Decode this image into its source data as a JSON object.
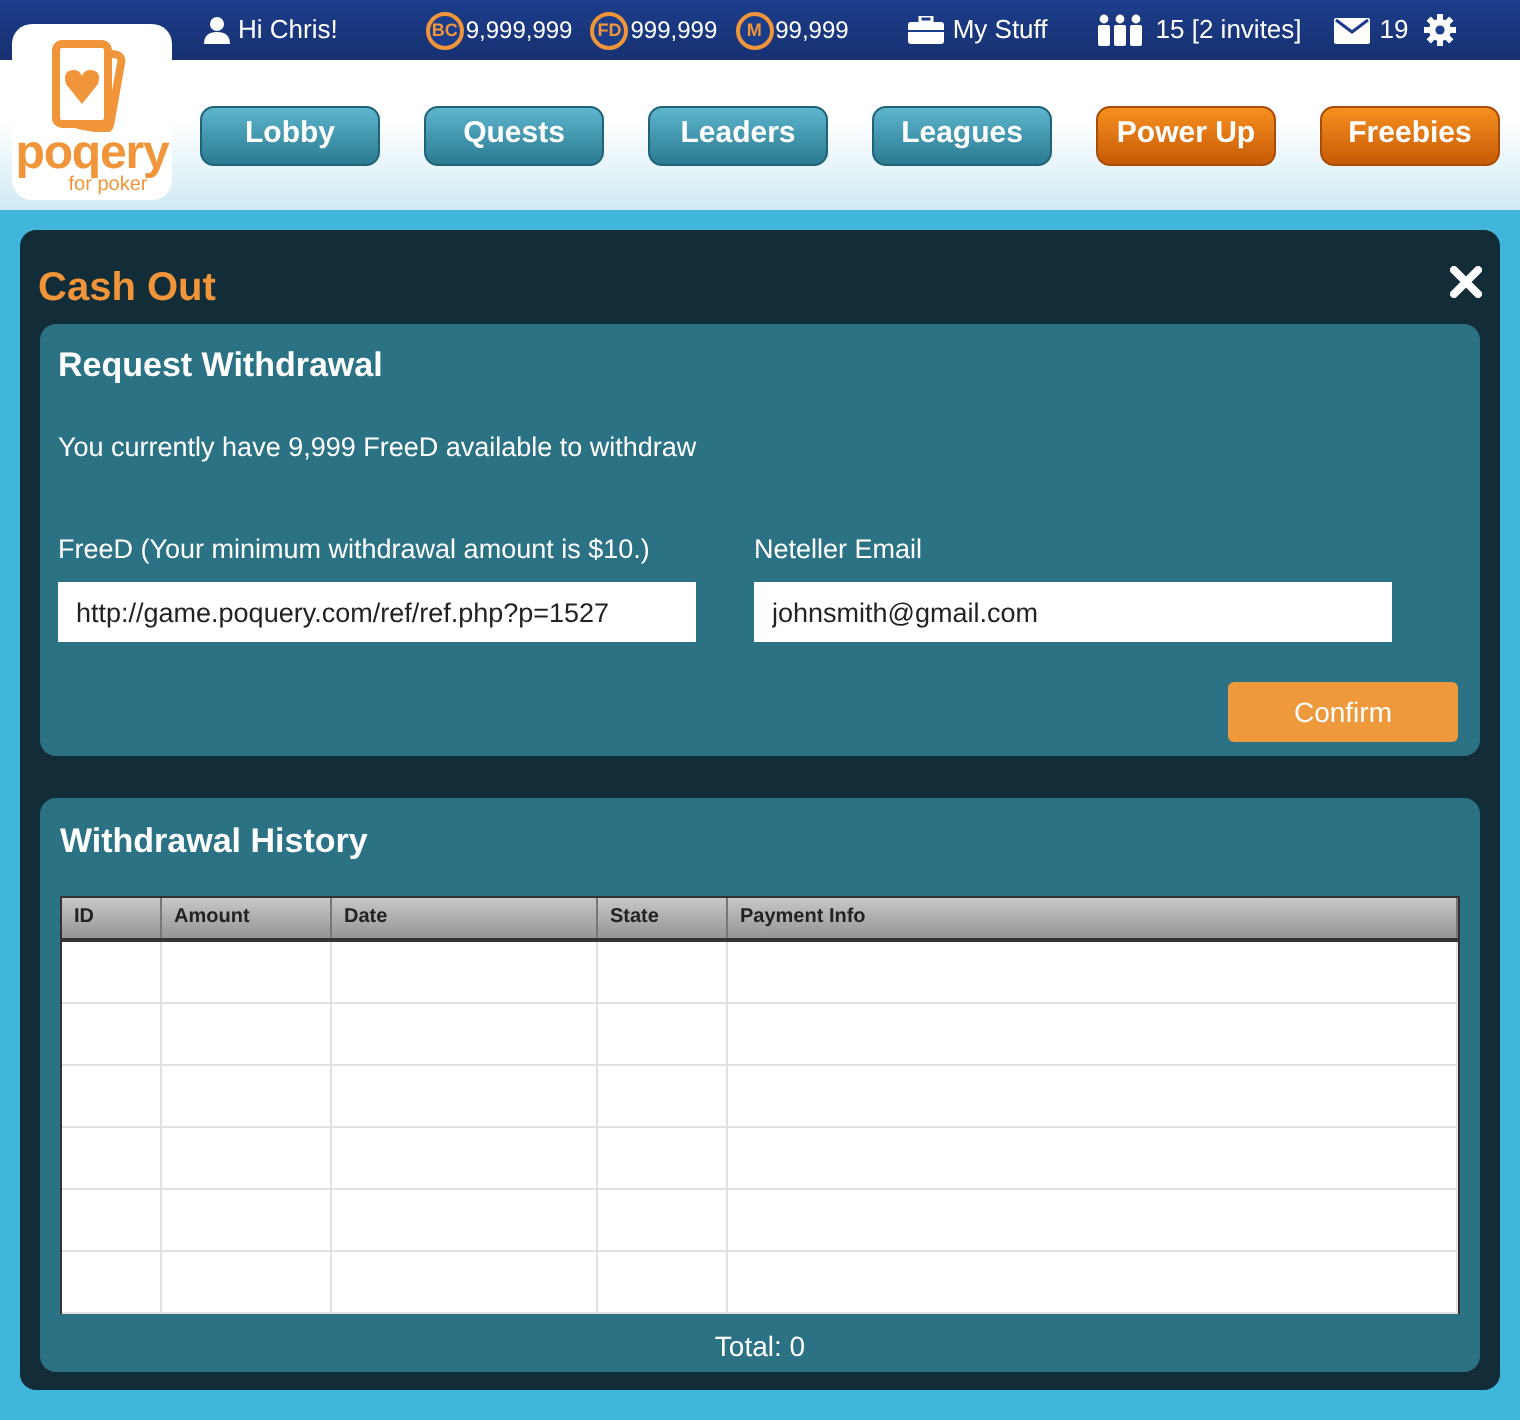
{
  "top_bar": {
    "greeting": "Hi Chris!",
    "currencies": [
      {
        "badge": "BC",
        "amount": "9,999,999"
      },
      {
        "badge": "FD",
        "amount": "999,999"
      },
      {
        "badge": "M",
        "amount": "99,999"
      }
    ],
    "my_stuff": "My Stuff",
    "friends": "15 [2 invites]",
    "messages": "19"
  },
  "logo": {
    "name": "poqery",
    "tagline": "for poker"
  },
  "nav": [
    {
      "label": "Lobby",
      "kind": "teal"
    },
    {
      "label": "Quests",
      "kind": "teal"
    },
    {
      "label": "Leaders",
      "kind": "teal"
    },
    {
      "label": "Leagues",
      "kind": "teal"
    },
    {
      "label": "Power Up",
      "kind": "orange"
    },
    {
      "label": "Freebies",
      "kind": "orange"
    }
  ],
  "dialog": {
    "title": "Cash Out",
    "request": {
      "title": "Request Withdrawal",
      "info": "You currently have 9,999 FreeD available to withdraw",
      "fields": [
        {
          "label": "FreeD (Your minimum withdrawal amount is $10.)",
          "value": "http://game.poquery.com/ref/ref.php?p=1527"
        },
        {
          "label": "Neteller Email",
          "value": "johnsmith@gmail.com"
        }
      ],
      "button": "Confirm"
    },
    "history": {
      "title": "Withdrawal History",
      "columns": [
        "ID",
        "Amount",
        "Date",
        "State",
        "Payment Info"
      ],
      "total": "Total: 0"
    }
  }
}
